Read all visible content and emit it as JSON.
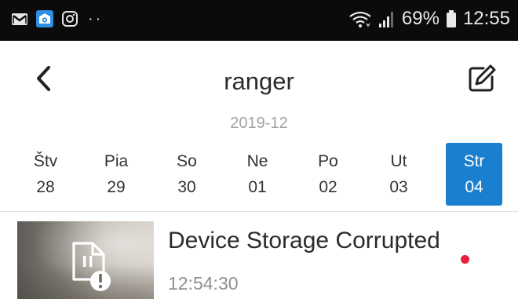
{
  "status_bar": {
    "left_icons": [
      "gmail-icon",
      "camera-app-icon",
      "instagram-icon"
    ],
    "more_indicator": "··",
    "battery_percent": "69%",
    "time": "12:55"
  },
  "header": {
    "title": "ranger",
    "back_icon": "chevron-left-icon",
    "edit_icon": "edit-icon"
  },
  "calendar": {
    "month": "2019-12",
    "days": [
      {
        "name": "Štv",
        "date": "28"
      },
      {
        "name": "Pia",
        "date": "29"
      },
      {
        "name": "So",
        "date": "30"
      },
      {
        "name": "Ne",
        "date": "01"
      },
      {
        "name": "Po",
        "date": "02"
      },
      {
        "name": "Ut",
        "date": "03"
      },
      {
        "name": "Str",
        "date": "04"
      }
    ],
    "selected_index": 6,
    "selected_color": "#1a7fcf"
  },
  "events": [
    {
      "title": "Device Storage Corrupted",
      "time": "12:54:30",
      "thumbnail_icon": "corrupted-file-icon",
      "unread": true,
      "unread_color": "#e8203a"
    }
  ]
}
